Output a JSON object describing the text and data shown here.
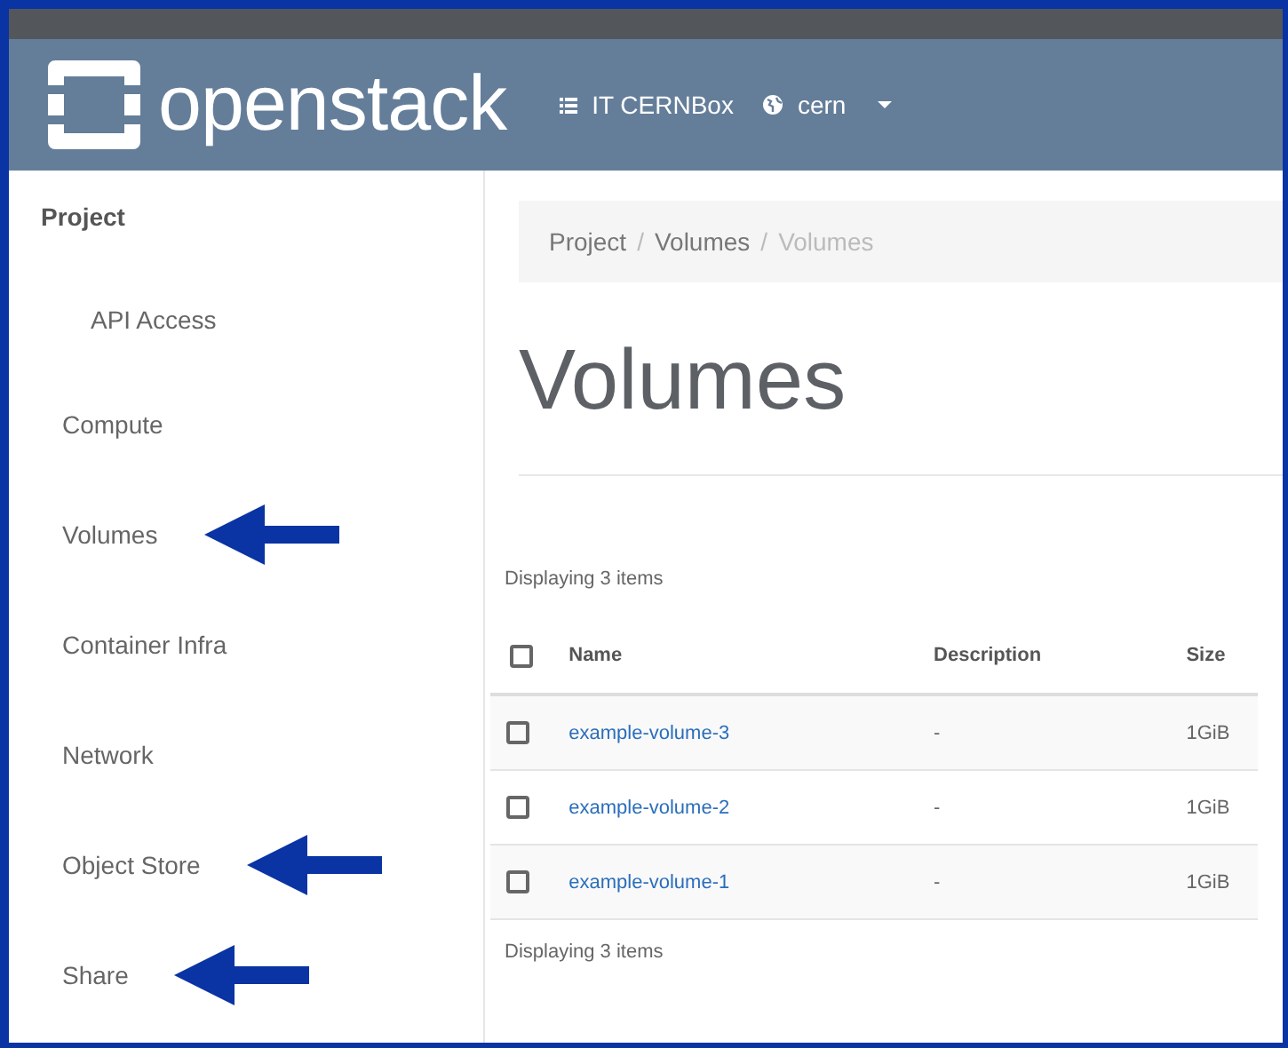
{
  "header": {
    "logo": "openstack",
    "project": "IT CERNBox",
    "region": "cern"
  },
  "sidebar": {
    "title": "Project",
    "children": [
      {
        "label": "API Access",
        "annotated": false
      }
    ],
    "items": [
      {
        "label": "Compute",
        "annotated": false
      },
      {
        "label": "Volumes",
        "annotated": true
      },
      {
        "label": "Container Infra",
        "annotated": false
      },
      {
        "label": "Network",
        "annotated": false
      },
      {
        "label": "Object Store",
        "annotated": true
      },
      {
        "label": "Share",
        "annotated": true
      }
    ]
  },
  "breadcrumb": {
    "separator": "/",
    "items": [
      "Project",
      "Volumes",
      "Volumes"
    ]
  },
  "page_title": "Volumes",
  "table": {
    "count_top": "Displaying 3 items",
    "count_bottom": "Displaying 3 items",
    "select_all_checked": false,
    "columns": [
      "Name",
      "Description",
      "Size"
    ],
    "rows": [
      {
        "name": "example-volume-3",
        "description": "-",
        "size": "1GiB",
        "checked": false
      },
      {
        "name": "example-volume-2",
        "description": "-",
        "size": "1GiB",
        "checked": false
      },
      {
        "name": "example-volume-1",
        "description": "-",
        "size": "1GiB",
        "checked": false
      }
    ]
  }
}
